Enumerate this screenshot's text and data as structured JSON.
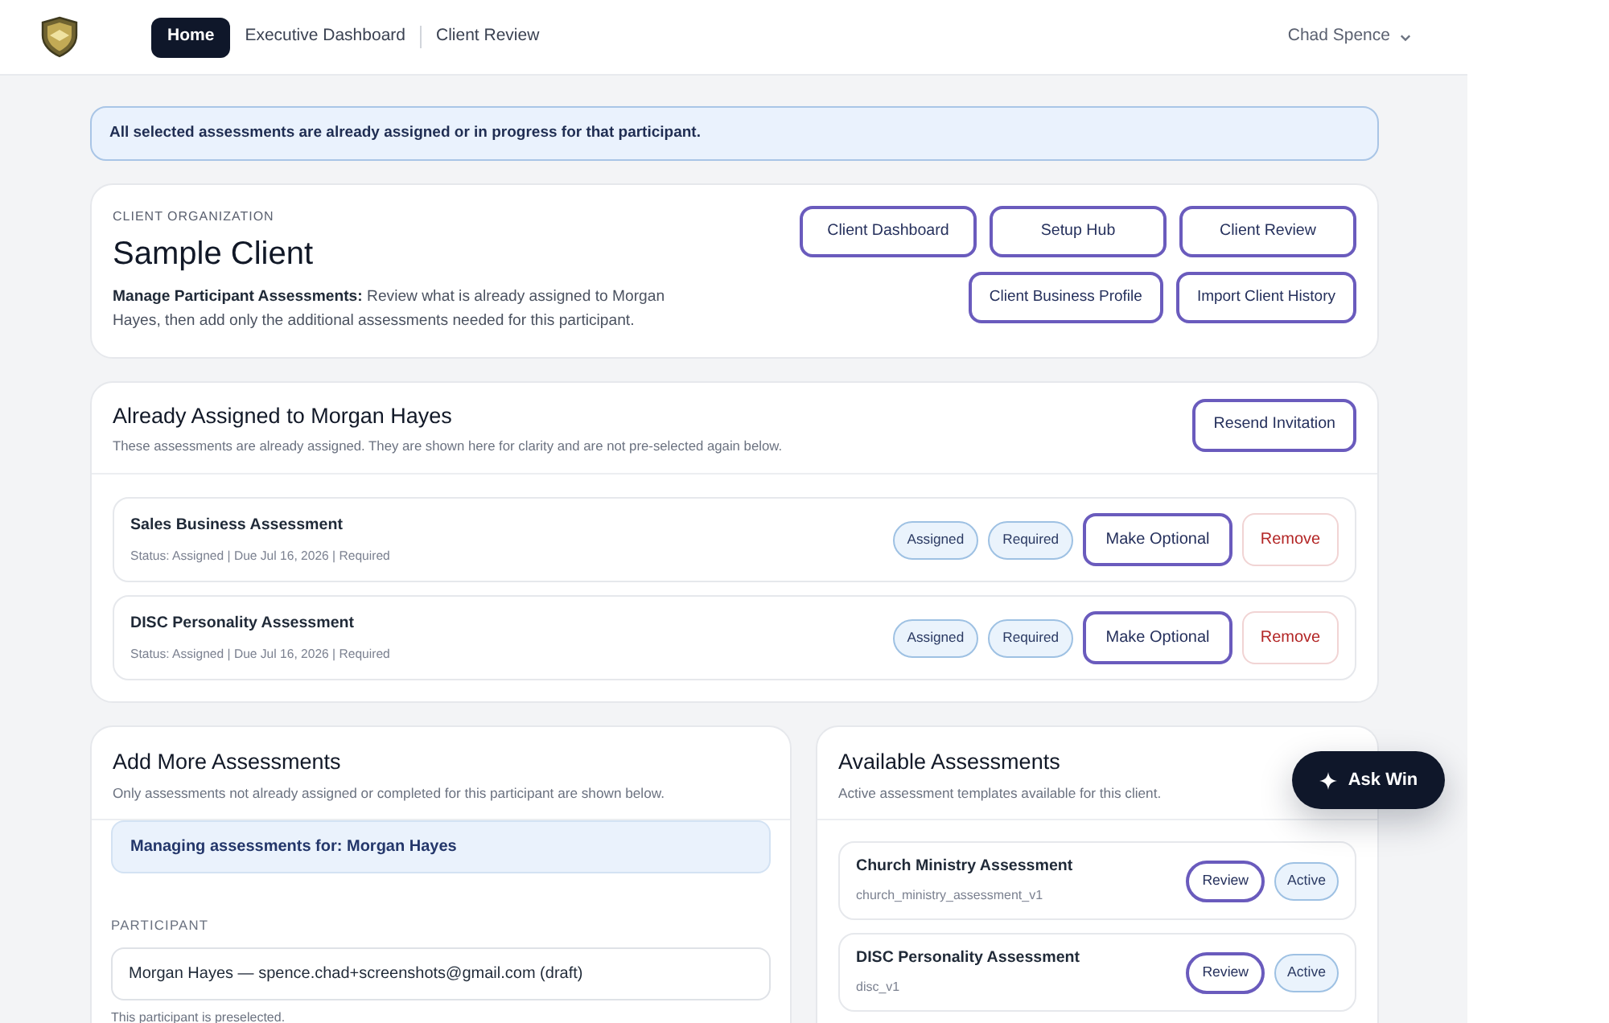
{
  "header": {
    "nav": [
      {
        "label": "Home",
        "selected": true
      },
      {
        "label": "Executive Dashboard",
        "selected": false
      },
      {
        "label": "Client Review",
        "selected": false
      }
    ],
    "user": "Chad Spence"
  },
  "alert": "All selected assessments are already assigned or in progress for that participant.",
  "client": {
    "eyebrow": "CLIENT ORGANIZATION",
    "name": "Sample Client",
    "description": "**Manage Participant Assessments:** Review what is already assigned to Morgan Hayes, then add only the additional assessments needed for this participant.",
    "button_rows": [
      [
        "Client Dashboard",
        "Setup Hub",
        "Client Review"
      ],
      [
        "Client Business Profile",
        "Import Client History"
      ]
    ]
  },
  "assigned": {
    "title": "Already Assigned to Morgan Hayes",
    "subtitle": "These assessments are already assigned. They are shown here for clarity and are not pre-selected again below.",
    "action": "Resend Invitation",
    "items": [
      {
        "name": "Sales Business Assessment",
        "meta": "Status: Assigned | Due Jul 16, 2026 | Required",
        "badges": [
          "Assigned",
          "Required"
        ],
        "buttons": [
          {
            "label": "Make Optional",
            "kind": "primary"
          },
          {
            "label": "Remove",
            "kind": "danger"
          }
        ]
      },
      {
        "name": "DISC Personality Assessment",
        "meta": "Status: Assigned | Due Jul 16, 2026 | Required",
        "badges": [
          "Assigned",
          "Required"
        ],
        "buttons": [
          {
            "label": "Make Optional",
            "kind": "primary"
          },
          {
            "label": "Remove",
            "kind": "danger"
          }
        ]
      }
    ]
  },
  "add_more": {
    "title": "Add More Assessments",
    "subtitle": "Only assessments not already assigned or completed for this participant are shown below.",
    "notice": "Managing assessments for: Morgan Hayes",
    "field_label": "PARTICIPANT",
    "field_value": "Morgan Hayes — spence.chad+screenshots@gmail.com (draft)",
    "help": "This participant is preselected."
  },
  "available": {
    "title": "Available Assessments",
    "subtitle": "Active assessment templates available for this client.",
    "items": [
      {
        "name": "Church Ministry Assessment",
        "code": "church_ministry_assessment_v1",
        "action": "Review",
        "status": "Active"
      },
      {
        "name": "DISC Personality Assessment",
        "code": "disc_v1",
        "action": "Review",
        "status": "Active"
      }
    ]
  },
  "assistant_button": "Ask Win"
}
